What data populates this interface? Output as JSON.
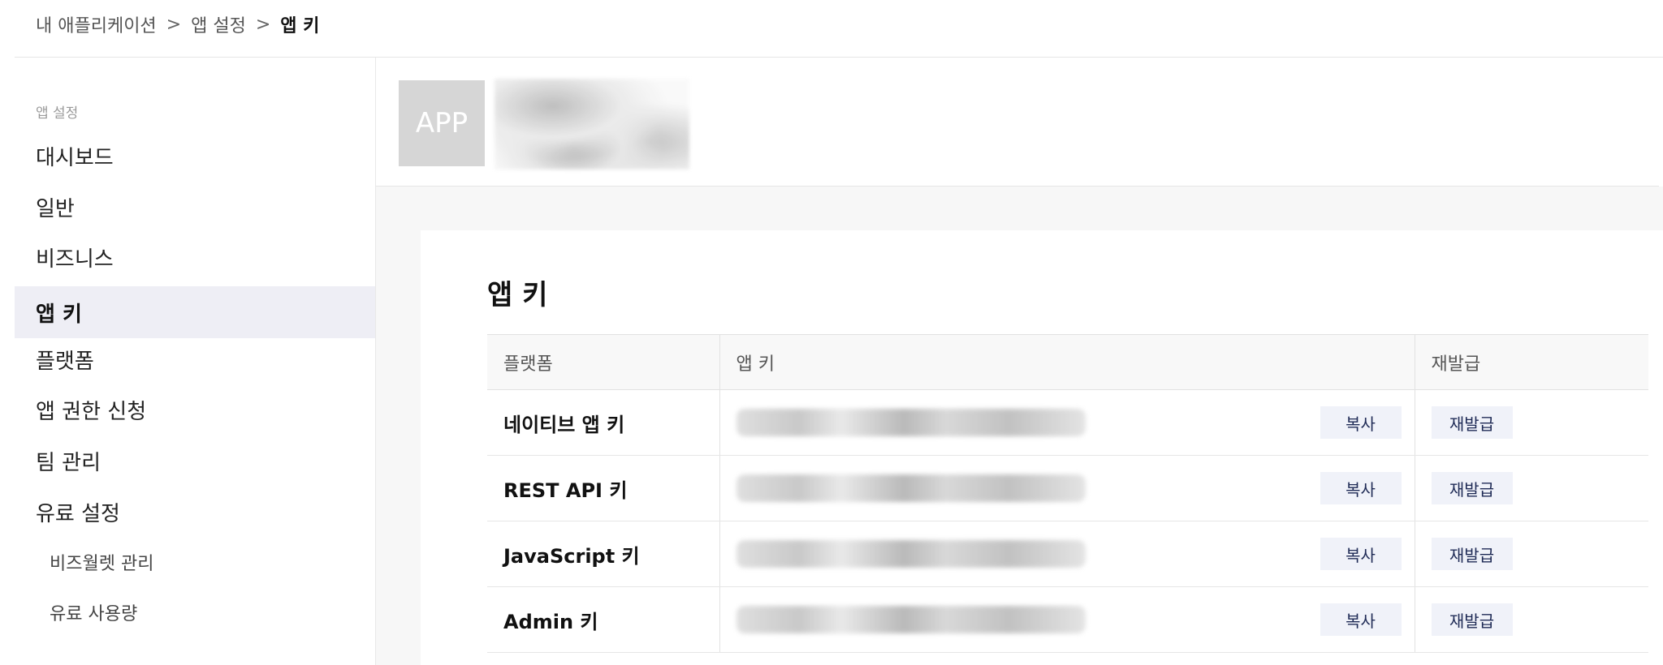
{
  "breadcrumb": {
    "item1": "내 애플리케이션",
    "item2": "앱 설정",
    "item3": "앱 키",
    "separator": ">"
  },
  "sidebar": {
    "section_label": "앱 설정",
    "items": [
      {
        "label": "대시보드"
      },
      {
        "label": "일반"
      },
      {
        "label": "비즈니스"
      },
      {
        "label": "앱 키",
        "active": true
      },
      {
        "label": "플랫폼"
      },
      {
        "label": "앱 권한 신청"
      },
      {
        "label": "팀 관리"
      },
      {
        "label": "유료 설정"
      }
    ],
    "sub_items": [
      {
        "label": "비즈월렛 관리"
      },
      {
        "label": "유료 사용량"
      }
    ]
  },
  "app_header": {
    "icon_text": "APP"
  },
  "card": {
    "title": "앱 키",
    "table": {
      "headers": {
        "platform": "플랫폼",
        "key": "앱 키",
        "reissue": "재발급"
      },
      "rows": [
        {
          "platform": "네이티브 앱 키",
          "copy": "복사",
          "reissue": "재발급"
        },
        {
          "platform": "REST API 키",
          "copy": "복사",
          "reissue": "재발급"
        },
        {
          "platform": "JavaScript 키",
          "copy": "복사",
          "reissue": "재발급"
        },
        {
          "platform": "Admin 키",
          "copy": "복사",
          "reissue": "재발급"
        }
      ]
    }
  },
  "colors": {
    "active_bg": "#eeeef5",
    "button_bg": "#f0f2f9",
    "button_text": "#1e2a55"
  }
}
